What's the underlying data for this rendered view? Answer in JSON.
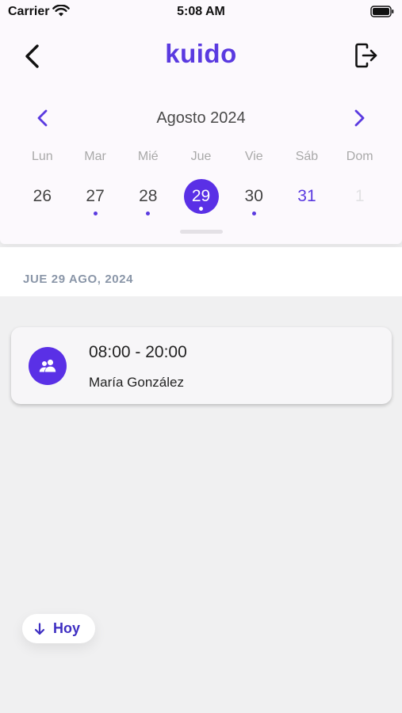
{
  "status_bar": {
    "carrier": "Carrier",
    "time": "5:08 AM"
  },
  "header": {
    "logo": "kuido",
    "back_icon": "chevron-left-icon",
    "logout_icon": "logout-icon"
  },
  "calendar": {
    "month_label": "Agosto 2024",
    "weekdays": [
      "Lun",
      "Mar",
      "Mié",
      "Jue",
      "Vie",
      "Sáb",
      "Dom"
    ],
    "days": [
      {
        "label": "26",
        "has_event": false,
        "state": "normal"
      },
      {
        "label": "27",
        "has_event": true,
        "state": "normal"
      },
      {
        "label": "28",
        "has_event": true,
        "state": "normal"
      },
      {
        "label": "29",
        "has_event": true,
        "state": "selected"
      },
      {
        "label": "30",
        "has_event": true,
        "state": "normal"
      },
      {
        "label": "31",
        "has_event": false,
        "state": "weekend"
      },
      {
        "label": "1",
        "has_event": false,
        "state": "disabled"
      }
    ]
  },
  "agenda": {
    "date_header": "JUE 29 AGO, 2024",
    "shifts": [
      {
        "time": "08:00 - 20:00",
        "person": "María González",
        "icon": "people-icon"
      }
    ]
  },
  "today_button": {
    "label": "Hoy",
    "icon": "arrow-down-icon"
  },
  "colors": {
    "accent": "#5a30e6",
    "brand": "#5a3ae0",
    "background": "#f0f0f1",
    "panel": "#fcf9fd"
  }
}
